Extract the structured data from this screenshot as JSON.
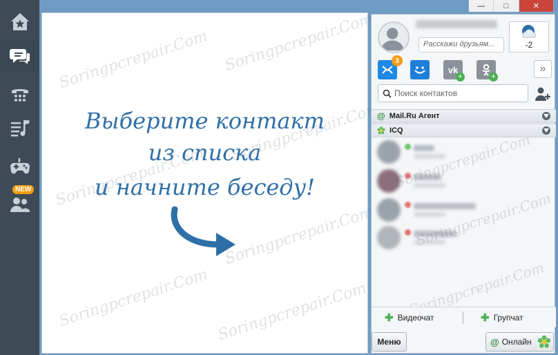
{
  "sidebar": {
    "items": [
      {
        "icon": "home-star-icon",
        "name": "sidebar-item-home"
      },
      {
        "icon": "chat-icon",
        "name": "sidebar-item-chats"
      },
      {
        "icon": "phone-icon",
        "name": "sidebar-item-calls"
      },
      {
        "icon": "music-icon",
        "name": "sidebar-item-music"
      },
      {
        "icon": "gamepad-icon",
        "name": "sidebar-item-games"
      },
      {
        "icon": "people-icon",
        "name": "sidebar-item-new",
        "badge": "NEW"
      }
    ]
  },
  "chat_area": {
    "line1": "Выберите контакт",
    "line2": "из списка",
    "line3": "и начните беседу!"
  },
  "watermark": "Soringpcrepair.Com",
  "window_controls": {
    "minimize": "—",
    "maximize": "□",
    "close": "✕"
  },
  "profile": {
    "status_placeholder": "Расскажи друзьям...",
    "weather_temp": "-2"
  },
  "services": {
    "mail_badge": "3",
    "more": "»"
  },
  "search": {
    "placeholder": "Поиск контактов"
  },
  "groups": {
    "mailru": "Mail.Ru Агент",
    "icq": "ICQ"
  },
  "bottom": {
    "videochat": "Видеочат",
    "groupchat": "Групчат"
  },
  "menu_label": "Меню",
  "status_label": "Онлайн",
  "colors": {
    "accent": "#2f6fa8",
    "sidebar": "#3e4b57",
    "badge": "#f39c12",
    "online": "#4caf50"
  }
}
